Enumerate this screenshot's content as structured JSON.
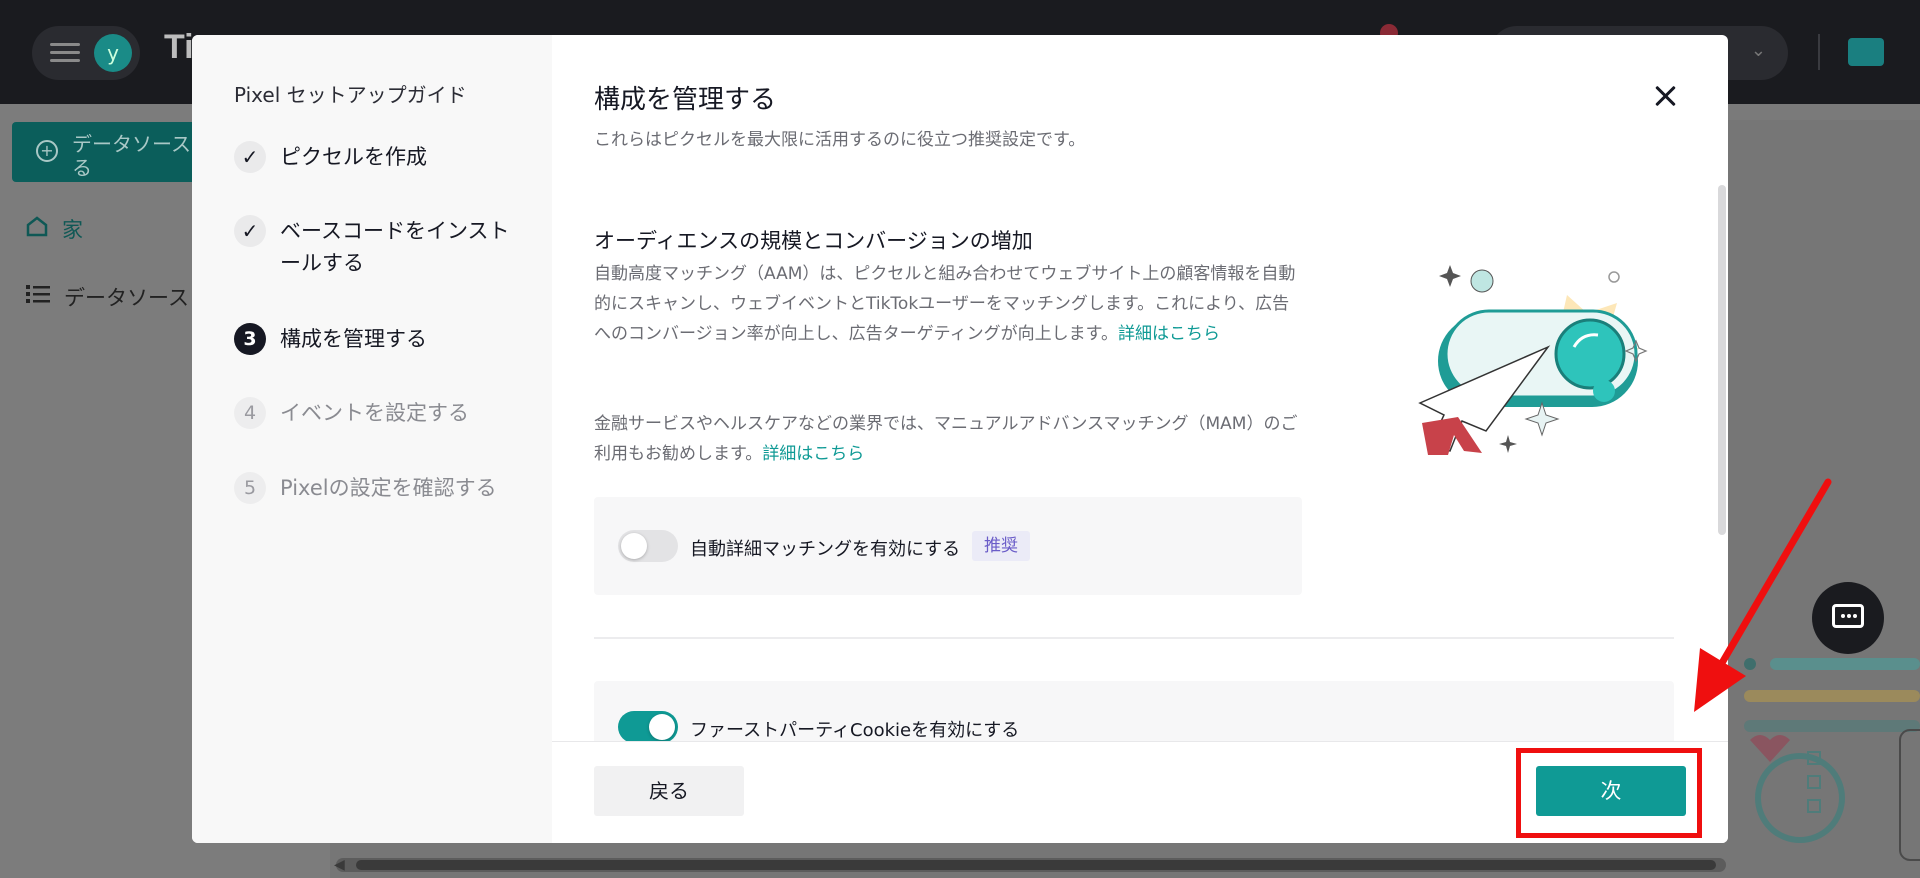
{
  "app": {
    "brand": "Ti",
    "avatar_letter": "y"
  },
  "sidebar": {
    "new_source": "データソース\nる",
    "items": [
      {
        "label": "家",
        "icon": "home-icon"
      },
      {
        "label": "データソース",
        "icon": "list-icon"
      }
    ]
  },
  "modal": {
    "guide_title": "Pixel セットアップガイド",
    "steps": [
      {
        "marker": "✓",
        "label": "ピクセルを作成",
        "state": "done"
      },
      {
        "marker": "✓",
        "label": "ベースコードをインストールする",
        "state": "done"
      },
      {
        "marker": "3",
        "label": "構成を管理する",
        "state": "active"
      },
      {
        "marker": "4",
        "label": "イベントを設定する",
        "state": "todo"
      },
      {
        "marker": "5",
        "label": "Pixelの設定を確認する",
        "state": "todo"
      }
    ],
    "title": "構成を管理する",
    "subtitle": "これらはピクセルを最大限に活用するのに役立つ推奨設定です。",
    "section_title": "オーディエンスの規模とコンバージョンの増加",
    "para1": "自動高度マッチング（AAM）は、ピクセルと組み合わせてウェブサイト上の顧客情報を自動的にスキャンし、ウェブイベントとTikTokユーザーをマッチングします。これにより、広告へのコンバージョン率が向上し、広告ターゲティングが向上します。",
    "para1_link": "詳細はこちら",
    "para2": "金融サービスやヘルスケアなどの業界では、マニュアルアドバンスマッチング（MAM）のご利用もお勧めします。",
    "para2_link": "詳細はこちら",
    "aam_toggle": {
      "label": "自動詳細マッチングを有効にする",
      "tag": "推奨",
      "on": false
    },
    "cookie_toggle": {
      "label": "ファーストパーティCookieを有効にする",
      "on": true
    },
    "back_label": "戻る",
    "next_label": "次"
  },
  "colors": {
    "accent": "#0f9a95",
    "annotation": "#ef0f0f"
  }
}
